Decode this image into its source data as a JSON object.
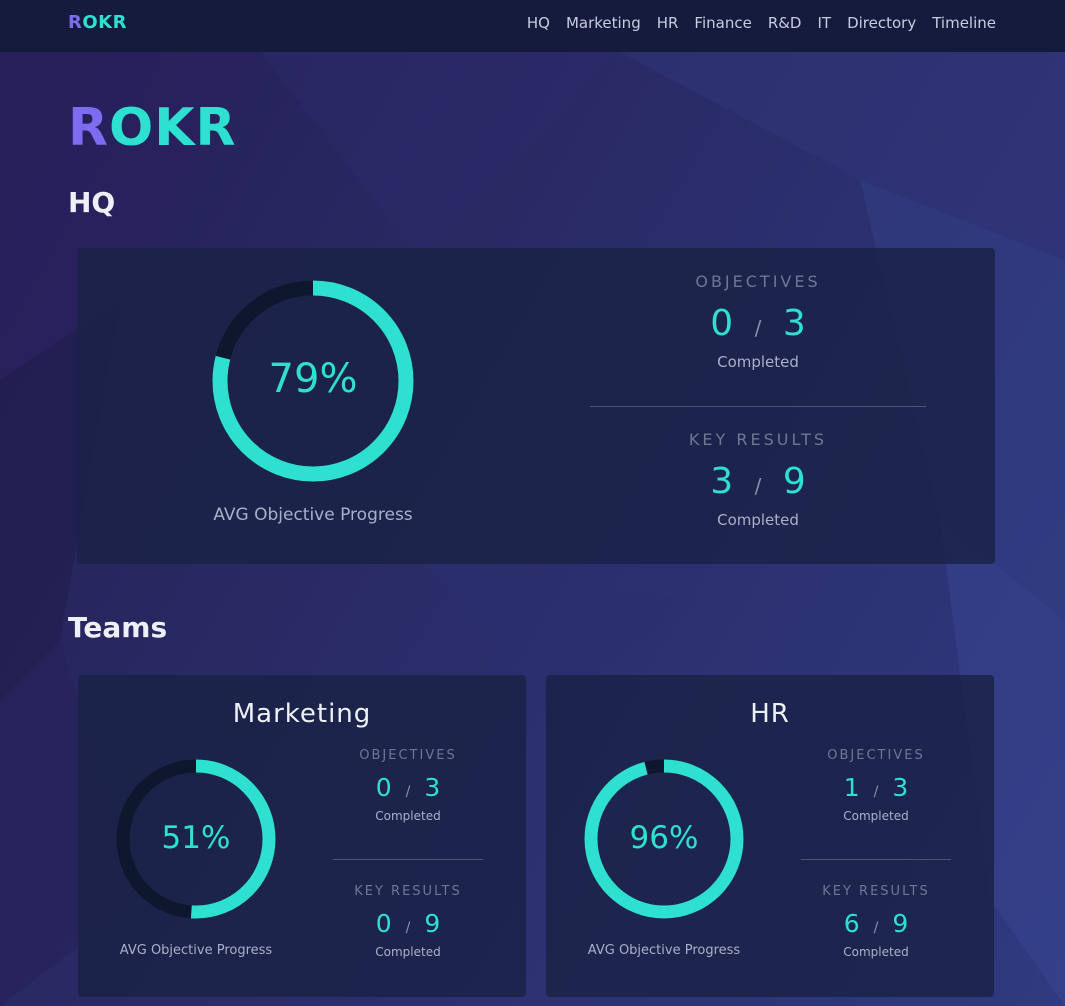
{
  "nav": {
    "brand_first": "R",
    "brand_rest": "OKR",
    "links": [
      "HQ",
      "Marketing",
      "HR",
      "Finance",
      "R&D",
      "IT",
      "Directory",
      "Timeline"
    ]
  },
  "hero": {
    "title_first": "R",
    "title_rest": "OKR"
  },
  "hq": {
    "section_title": "HQ",
    "progress": 0.79,
    "progress_label": "79%",
    "avg_label": "AVG Objective Progress",
    "objectives": {
      "heading": "OBJECTIVES",
      "done": "0",
      "sep": "/",
      "total": "3",
      "sub": "Completed"
    },
    "key_results": {
      "heading": "KEY RESULTS",
      "done": "3",
      "sep": "/",
      "total": "9",
      "sub": "Completed"
    }
  },
  "teams": {
    "section_title": "Teams",
    "items": [
      {
        "name": "Marketing",
        "progress": 0.51,
        "progress_label": "51%",
        "avg_label": "AVG Objective Progress",
        "objectives": {
          "heading": "OBJECTIVES",
          "done": "0",
          "sep": "/",
          "total": "3",
          "sub": "Completed"
        },
        "key_results": {
          "heading": "KEY RESULTS",
          "done": "0",
          "sep": "/",
          "total": "9",
          "sub": "Completed"
        }
      },
      {
        "name": "HR",
        "progress": 0.96,
        "progress_label": "96%",
        "avg_label": "AVG Objective Progress",
        "objectives": {
          "heading": "OBJECTIVES",
          "done": "1",
          "sep": "/",
          "total": "3",
          "sub": "Completed"
        },
        "key_results": {
          "heading": "KEY RESULTS",
          "done": "6",
          "sep": "/",
          "total": "9",
          "sub": "Completed"
        }
      }
    ]
  },
  "colors": {
    "accent": "#2ee0cf",
    "brand_purple": "#7b6cf0",
    "ring_track": "#0f172e"
  }
}
